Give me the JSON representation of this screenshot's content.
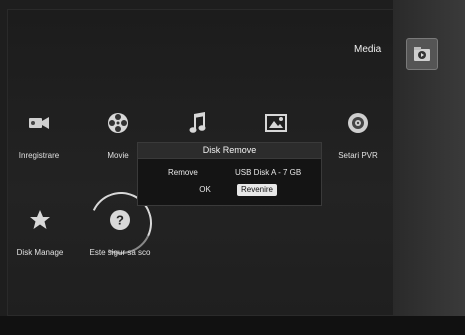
{
  "sidebar": {
    "media_label": "Media",
    "media_icon": "media-folder-icon"
  },
  "menu": {
    "items": [
      {
        "label": "Inregistrare",
        "icon": "camcorder-icon"
      },
      {
        "label": "Movie",
        "icon": "film-reel-icon"
      },
      {
        "label": "",
        "icon": "music-note-icon"
      },
      {
        "label": "",
        "icon": "picture-icon"
      },
      {
        "label": "Setari PVR",
        "icon": "disc-settings-icon"
      },
      {
        "label": "Disk Manage",
        "icon": "star-icon"
      },
      {
        "label": "Este sigur sa sco",
        "icon": "help-question-icon"
      }
    ]
  },
  "dialog": {
    "title": "Disk Remove",
    "remove_label": "Remove",
    "device": "USB Disk A - 7 GB",
    "ok_label": "OK",
    "return_label": "Revenire"
  }
}
